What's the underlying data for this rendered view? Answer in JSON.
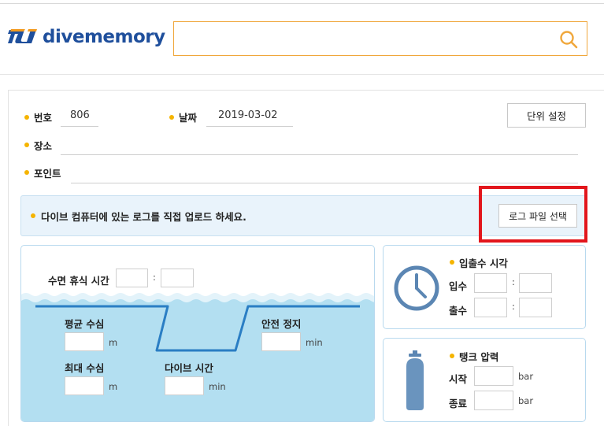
{
  "header": {
    "logo_text": "divememory",
    "search_placeholder": ""
  },
  "fields": {
    "number_label": "번호",
    "number_value": "806",
    "date_label": "날짜",
    "date_value": "2019-03-02",
    "place_label": "장소",
    "place_value": "",
    "point_label": "포인트",
    "point_value": ""
  },
  "unit_settings_label": "단위 설정",
  "upload": {
    "message": "다이브 컴퓨터에 있는 로그를 직접 업로드 하세요.",
    "select_button_label": "로그 파일 선택"
  },
  "dive": {
    "surface_interval_label": "수면 휴식 시간",
    "colon": ":",
    "avg_depth_label": "평균 수심",
    "max_depth_label": "최대 수심",
    "dive_time_label": "다이브 시간",
    "safety_stop_label": "안전 정지",
    "unit_m": "m",
    "unit_min": "min"
  },
  "entry_exit": {
    "title": "입출수 시각",
    "entry_label": "입수",
    "exit_label": "출수",
    "colon": ":"
  },
  "tank": {
    "title": "탱크 압력",
    "start_label": "시작",
    "end_label": "종료",
    "unit_bar": "bar"
  },
  "colors": {
    "accent_orange": "#f0a73b",
    "brand_blue": "#1f4f9c",
    "dot_yellow": "#f5b400",
    "water": "#b3dff1",
    "highlight_red": "#e2161c"
  }
}
